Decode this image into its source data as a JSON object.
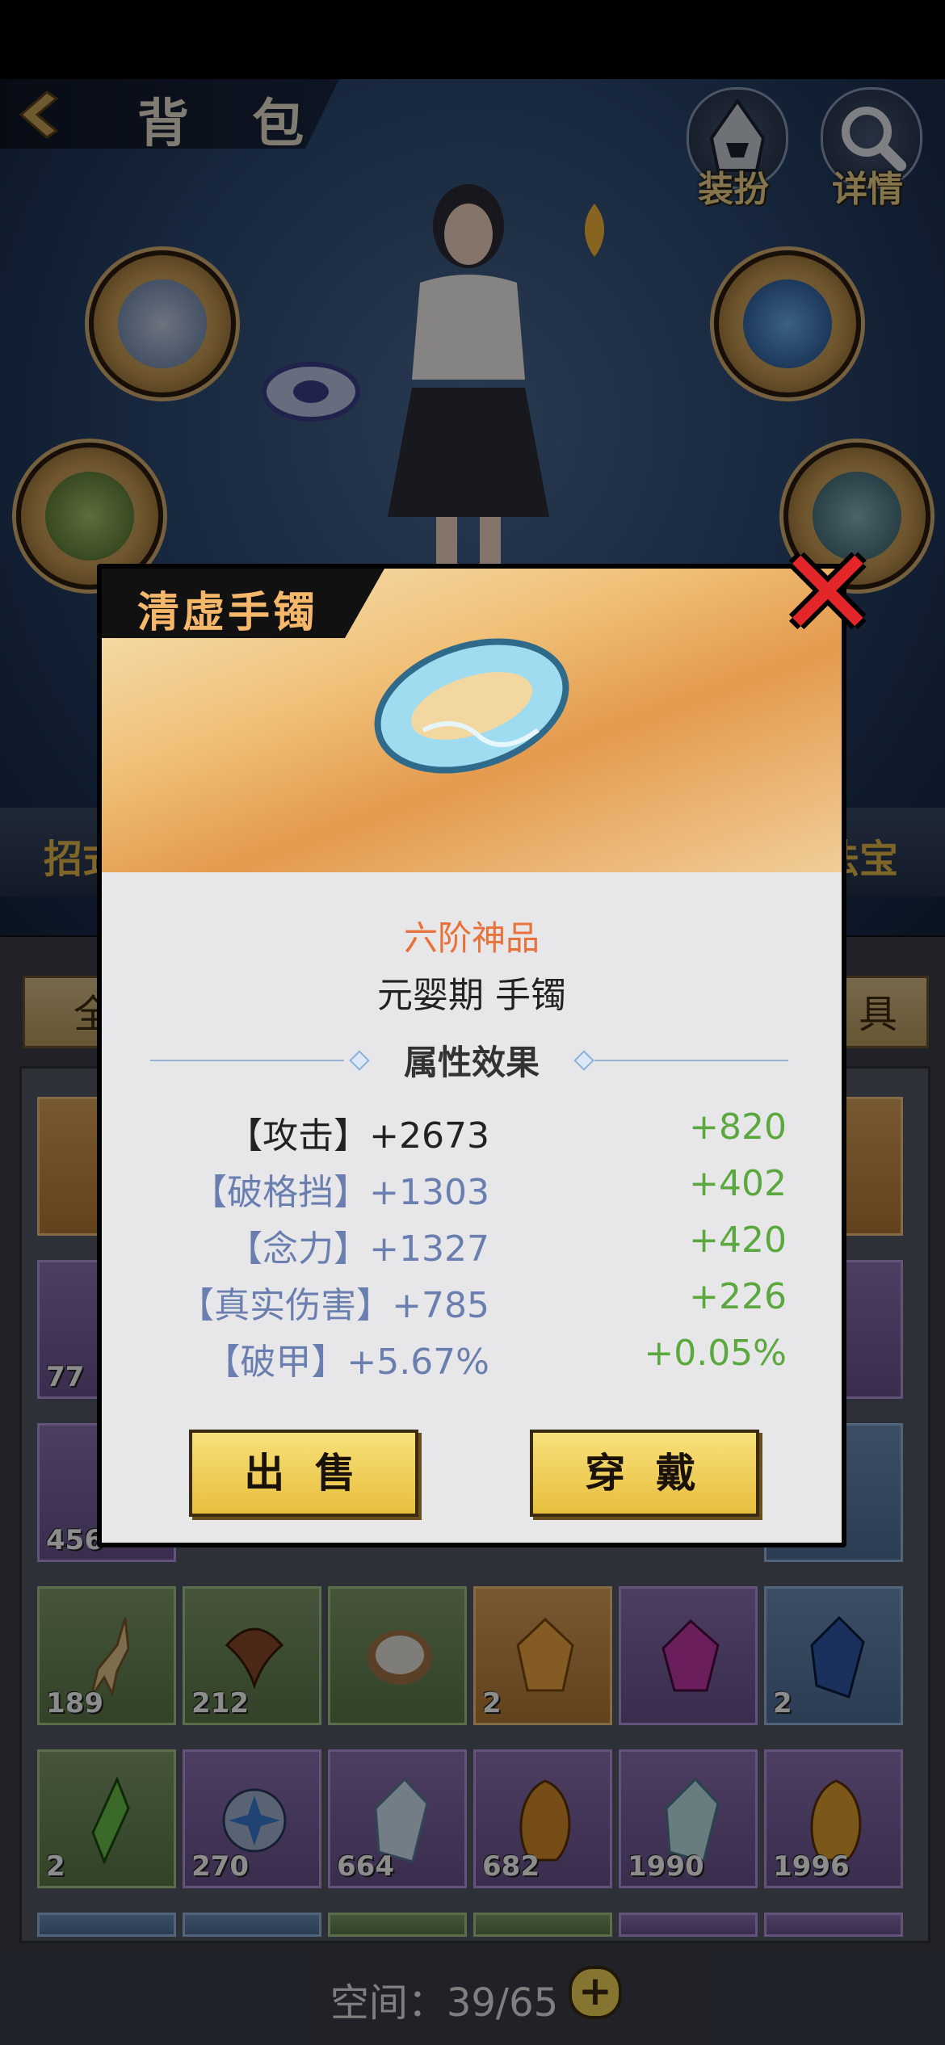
{
  "header": {
    "title": "背 包"
  },
  "top_buttons": [
    {
      "label": "装扮",
      "icon": "hooded-figure-icon"
    },
    {
      "label": "详情",
      "icon": "magnifier-icon"
    }
  ],
  "side_band": {
    "left": "招式",
    "right": "法宝"
  },
  "tabs": {
    "left": "全",
    "right": "具"
  },
  "dialog": {
    "title": "清虚手镯",
    "quality": "六阶神品",
    "subtitle": "元婴期 手镯",
    "attr_header": "属性效果",
    "stats": [
      {
        "name": "【攻击】+2673",
        "bonus": "+820"
      },
      {
        "name": "【破格挡】+1303",
        "bonus": "+402"
      },
      {
        "name": "【念力】+1327",
        "bonus": "+420"
      },
      {
        "name": "【真实伤害】+785",
        "bonus": "+226"
      },
      {
        "name": "【破甲】+5.67%",
        "bonus": "+0.05%"
      }
    ],
    "sell_label": "出 售",
    "wear_label": "穿 戴"
  },
  "inventory": {
    "row2_counts": [
      "77"
    ],
    "row3_counts": [
      "456"
    ],
    "row4": [
      {
        "count": "189",
        "quality": "green",
        "icon": "ginseng-icon"
      },
      {
        "count": "212",
        "quality": "green",
        "icon": "lingzhi-icon"
      },
      {
        "count": "",
        "quality": "green",
        "icon": "rice-bowl-icon"
      },
      {
        "count": "2",
        "quality": "orange",
        "icon": "amber-gem-icon"
      },
      {
        "count": "",
        "quality": "purple",
        "icon": "purple-crystal-icon"
      },
      {
        "count": "2",
        "quality": "blue",
        "icon": "blue-crystal-icon"
      }
    ],
    "row5": [
      {
        "count": "2",
        "quality": "green",
        "icon": "green-shard-icon"
      },
      {
        "count": "270",
        "quality": "purple",
        "icon": "star-disc-icon"
      },
      {
        "count": "664",
        "quality": "purple",
        "icon": "ice-crystal-icon"
      },
      {
        "count": "682",
        "quality": "purple",
        "icon": "amber-stone-icon"
      },
      {
        "count": "1990",
        "quality": "purple",
        "icon": "ice-crystal-icon"
      },
      {
        "count": "1996",
        "quality": "purple",
        "icon": "amber-stone-icon"
      }
    ]
  },
  "space": {
    "label": "空间：39/65"
  },
  "colors": {
    "accent_gold": "#f2d65a",
    "quality_orange": "#e8723a",
    "bonus_green": "#5aa83e",
    "close_red": "#e2262a"
  }
}
